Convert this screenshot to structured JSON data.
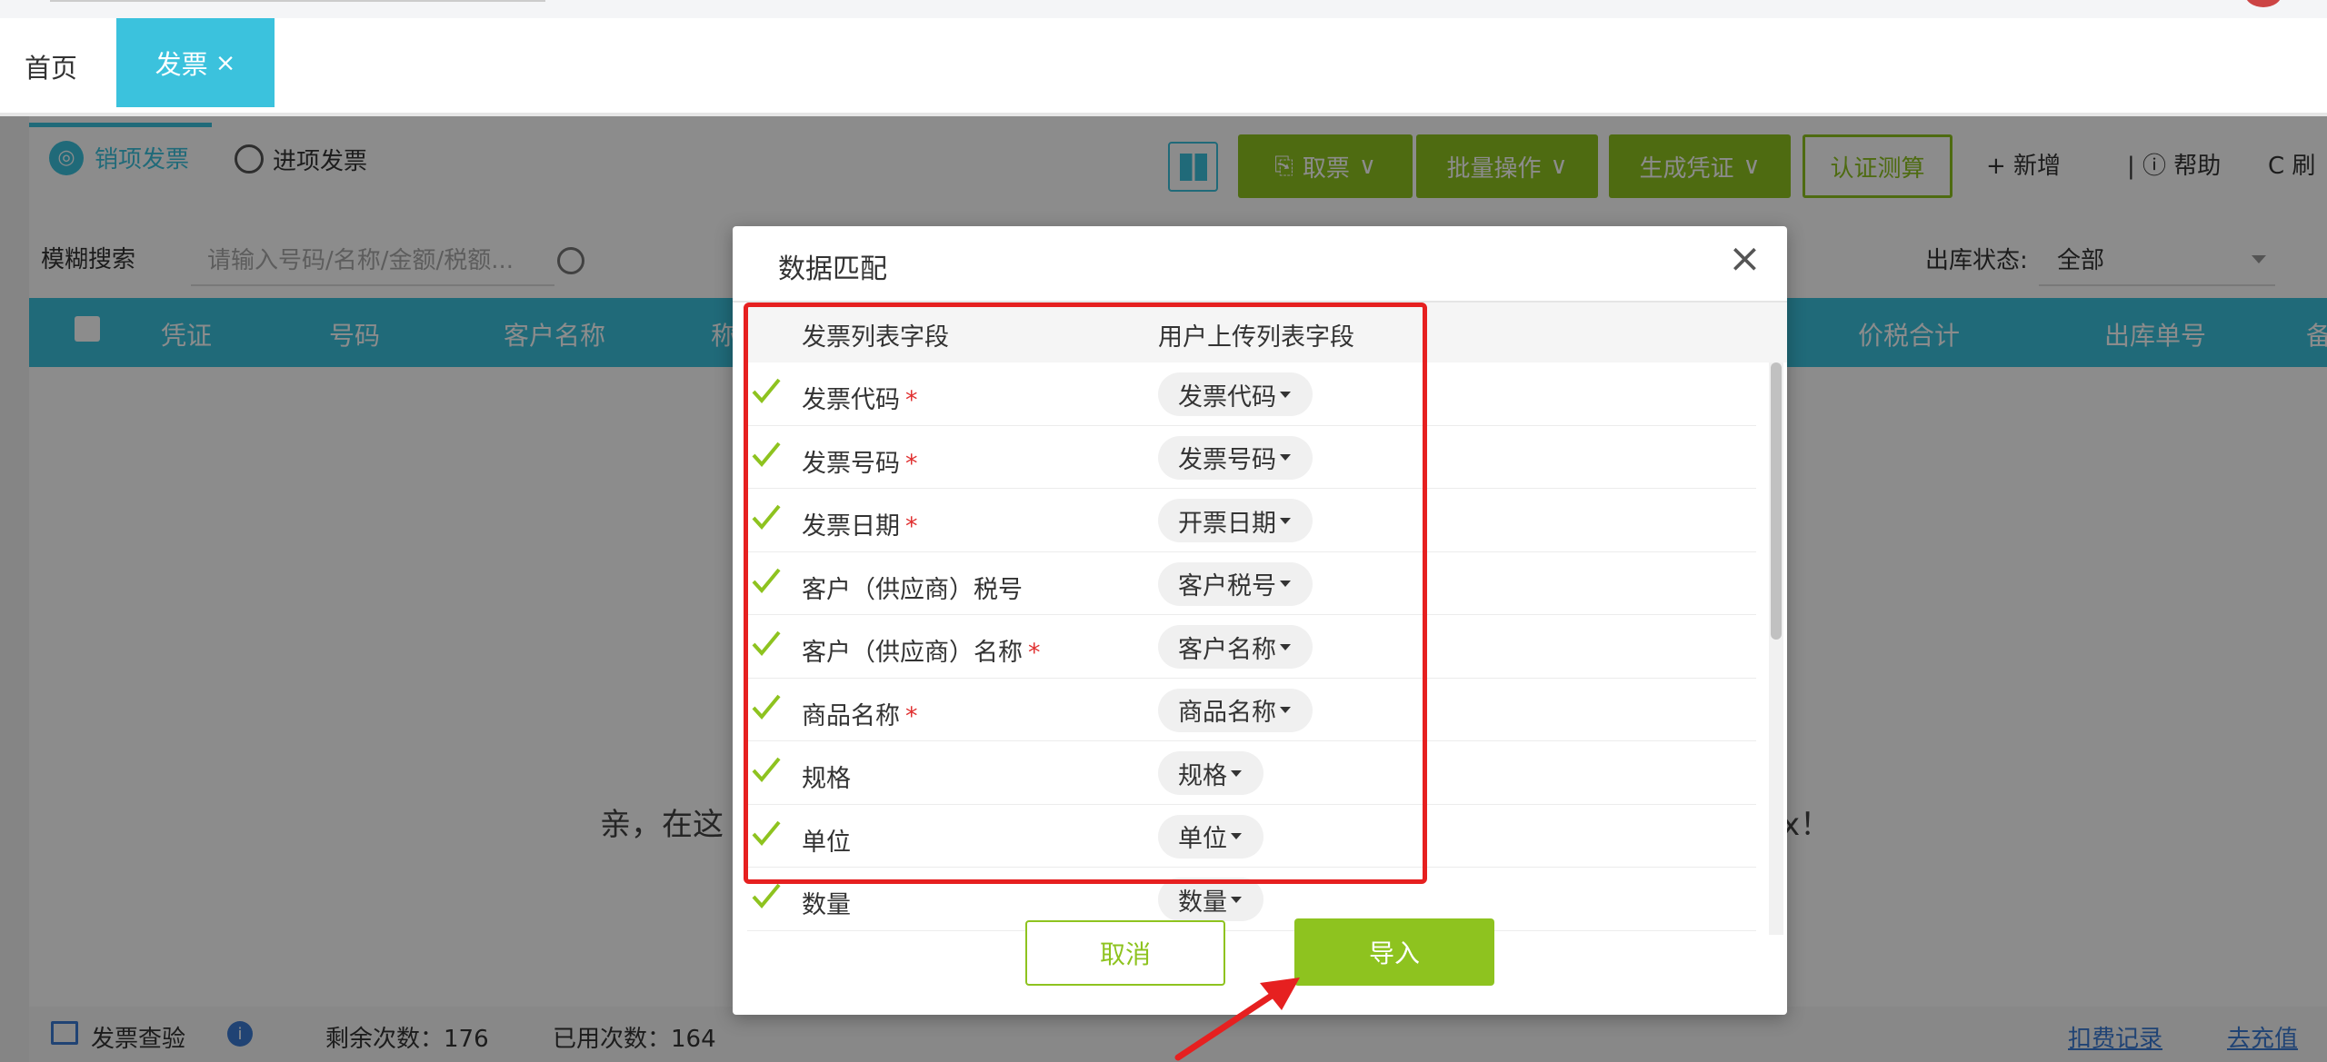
{
  "tabs": {
    "home": "首页",
    "invoice": "发票",
    "close": "×"
  },
  "subtabs": {
    "sales": "销项发票",
    "purchase": "进项发票"
  },
  "toolbar": {
    "fetch": "取票",
    "batch": "批量操作",
    "voucher": "生成凭证",
    "certify": "认证测算",
    "add": "+ 新增",
    "help": "| ⓘ 帮助",
    "refresh": "C 刷"
  },
  "search": {
    "mode": "模糊搜索",
    "placeholder": "请输入号码/名称/金额/税额..."
  },
  "status": {
    "label": "出库状态:",
    "value": "全部"
  },
  "table": {
    "columns": [
      "凭证",
      "号码",
      "客户名称",
      "称",
      "价税合计",
      "出库单号",
      "备"
    ]
  },
  "empty": {
    "head": "亲，在这",
    "tail": "x！"
  },
  "footer": {
    "check": "发票查验",
    "remaining": "剩余次数：176",
    "used": "已用次数：164",
    "fee_log": "扣费记录",
    "recharge": "去充值"
  },
  "modal": {
    "title": "数据匹配",
    "col_left": "发票列表字段",
    "col_right": "用户上传列表字段",
    "rows": [
      {
        "field": "发票代码",
        "required": "*",
        "mapped": "发票代码"
      },
      {
        "field": "发票号码",
        "required": "*",
        "mapped": "发票号码"
      },
      {
        "field": "发票日期",
        "required": "*",
        "mapped": "开票日期"
      },
      {
        "field": "客户（供应商）税号",
        "required": "",
        "mapped": "客户税号"
      },
      {
        "field": "客户（供应商）名称",
        "required": "*",
        "mapped": "客户名称"
      },
      {
        "field": "商品名称",
        "required": "*",
        "mapped": "商品名称"
      },
      {
        "field": "规格",
        "required": "",
        "mapped": "规格"
      },
      {
        "field": "单位",
        "required": "",
        "mapped": "单位"
      },
      {
        "field": "数量",
        "required": "",
        "mapped": "数量"
      }
    ],
    "cancel": "取消",
    "import": "导入"
  },
  "colors": {
    "accent": "#3bc2dd",
    "green": "#8ec31f",
    "danger": "#e62020"
  }
}
